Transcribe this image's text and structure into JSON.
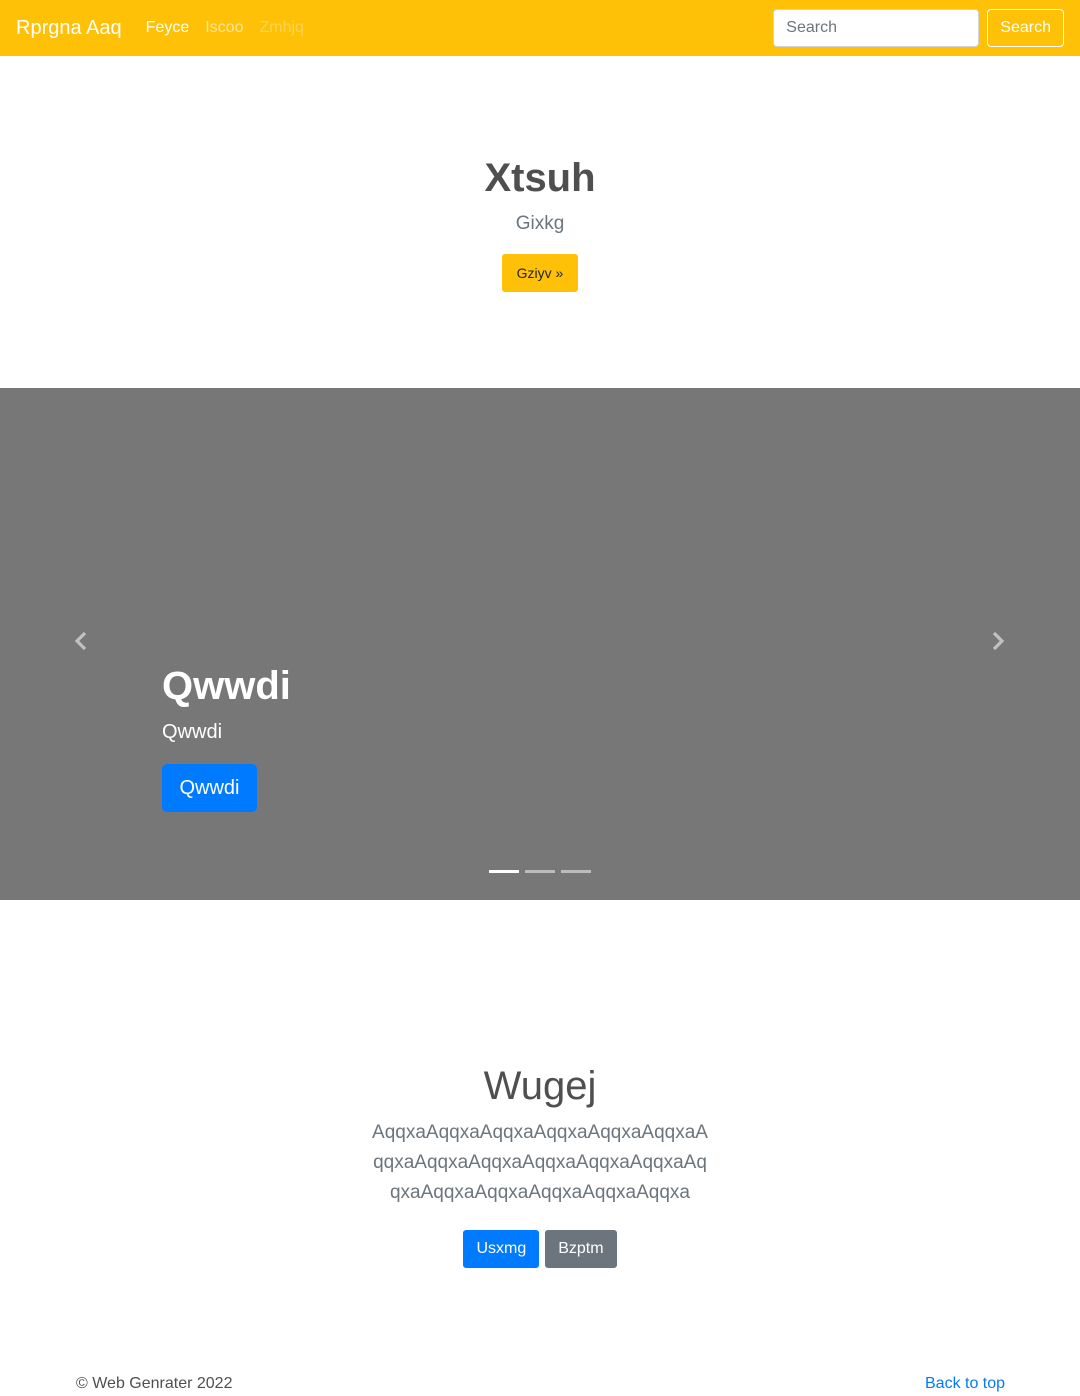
{
  "navbar": {
    "brand": "Rprgna Aaq",
    "links": [
      {
        "label": "Feyce",
        "state": "active"
      },
      {
        "label": "Iscoo",
        "state": "normal"
      },
      {
        "label": "Zmhjq",
        "state": "disabled"
      }
    ],
    "search_placeholder": "Search",
    "search_button": "Search",
    "bg_color": "#ffc107"
  },
  "hero": {
    "title": "Xtsuh",
    "subtitle": "Gixkg",
    "button": "Gziyv »"
  },
  "carousel": {
    "slide_title": "Qwwdi",
    "slide_subtitle": "Qwwdi",
    "slide_button": "Qwwdi",
    "prev_icon": "chevron-left-icon",
    "next_icon": "chevron-right-icon",
    "indicator_count": 3,
    "active_indicator": 0,
    "bg_color": "#777777"
  },
  "feature": {
    "title": "Wugej",
    "text": "AqqxaAqqxaAqqxaAqqxaAqqxaAqqxaAqqxaAqqxaAqqxaAqqxaAqqxaAqqxaAqqxaAqqxaAqqxaAqqxaAqqxaAqqxa",
    "primary_button": "Usxmg",
    "secondary_button": "Bzptm"
  },
  "footer": {
    "copyright": "© Web Genrater 2022",
    "back_to_top": "Back to top"
  }
}
